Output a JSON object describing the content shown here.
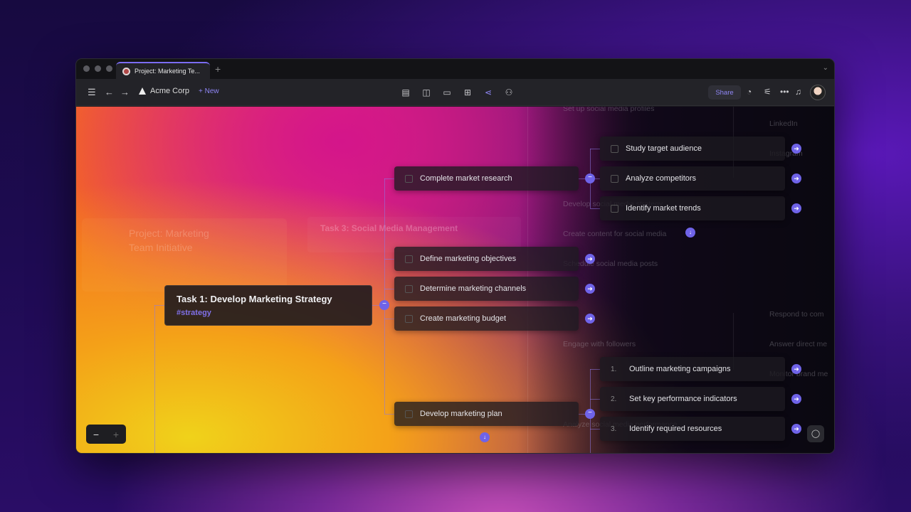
{
  "window": {
    "tab_title": "Project: Marketing Te...",
    "workspace": "Acme Corp",
    "new_label": "New",
    "share_label": "Share"
  },
  "icons": {
    "sidebar": "sidebar-toggle-icon",
    "back": "back-arrow-icon",
    "forward": "forward-arrow-icon",
    "views": [
      "list-view-icon",
      "board-view-icon",
      "calendar-view-icon",
      "table-view-icon",
      "mindmap-view-icon",
      "org-view-icon"
    ],
    "right": [
      "ai-icon",
      "filter-icon",
      "more-icon",
      "bell-icon"
    ]
  },
  "colors": {
    "accent": "#6f63e8",
    "tag": "#8070e8"
  },
  "mindmap": {
    "root_faded": "Project: Marketing\nTeam Initiative",
    "task3_faded": "Task 3: Social Media Management",
    "task1": {
      "title": "Task 1: Develop Marketing Strategy",
      "tag": "#strategy"
    },
    "level1": [
      "Complete market research",
      "Define marketing objectives",
      "Determine marketing channels",
      "Create marketing budget",
      "Develop marketing plan"
    ],
    "research_children": [
      "Study target audience",
      "Analyze competitors",
      "Identify market trends"
    ],
    "plan_children": [
      {
        "num": "1.",
        "label": "Outline marketing campaigns"
      },
      {
        "num": "2.",
        "label": "Set key performance indicators"
      },
      {
        "num": "3.",
        "label": "Identify required resources"
      }
    ],
    "ghost_items": [
      "Set up social media profiles",
      "LinkedIn",
      "Instagram",
      "Develop social media strategy",
      "Create content for social media",
      "Schedule social media posts",
      "Respond to com",
      "Engage with followers",
      "Answer direct me",
      "Monitor brand me",
      "Analyze social media performance"
    ]
  }
}
